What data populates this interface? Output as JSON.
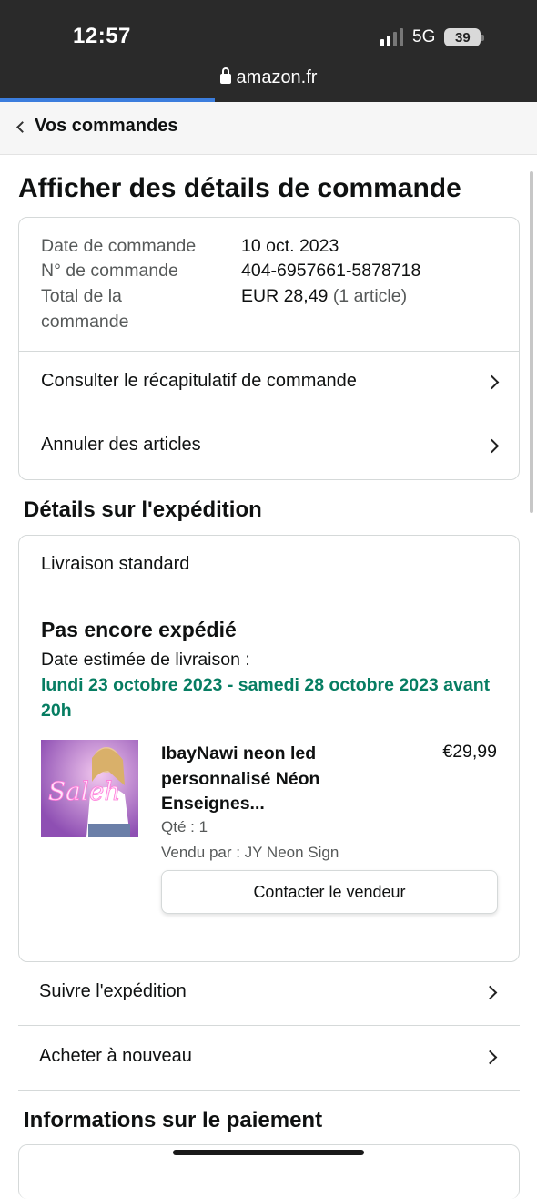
{
  "status_bar": {
    "time": "12:57",
    "network": "5G",
    "battery": "39",
    "url": "amazon.fr",
    "page_load_progress_fraction": 0.4
  },
  "nav": {
    "back_label": "Vos commandes"
  },
  "page_title": "Afficher des détails de commande",
  "order": {
    "date_label": "Date de commande",
    "date_value": "10 oct. 2023",
    "number_label": "N° de commande",
    "number_value": "404-6957661-5878718",
    "total_label_line1": "Total de la",
    "total_label_line2": "commande",
    "total_value": "EUR 28,49",
    "total_count": "(1 article)",
    "actions": [
      {
        "label": "Consulter le récapitulatif de commande"
      },
      {
        "label": "Annuler des articles"
      }
    ]
  },
  "shipment": {
    "section_title": "Détails sur l'expédition",
    "method": "Livraison standard",
    "status": "Pas encore expédié",
    "estimated_label": "Date estimée de livraison :",
    "estimated_date": "lundi 23 octobre 2023 - samedi 28 octobre 2023 avant 20h",
    "item": {
      "title": "IbayNawi neon led personnalisé Néon Enseignes...",
      "price": "€29,99",
      "quantity": "Qté : 1",
      "seller": "Vendu par : JY Neon Sign",
      "contact_label": "Contacter le vendeur",
      "image_neon_text": "Saleh"
    },
    "actions": [
      {
        "label": "Suivre l'expédition"
      },
      {
        "label": "Acheter à nouveau"
      }
    ]
  },
  "payment": {
    "section_title": "Informations sur le paiement"
  },
  "colors": {
    "status_bar_bg": "#2a2a2a",
    "progress_accent": "#3b7ddd",
    "delivery_green": "#067d62",
    "border": "#d5d9d9",
    "muted_text": "#565959"
  }
}
